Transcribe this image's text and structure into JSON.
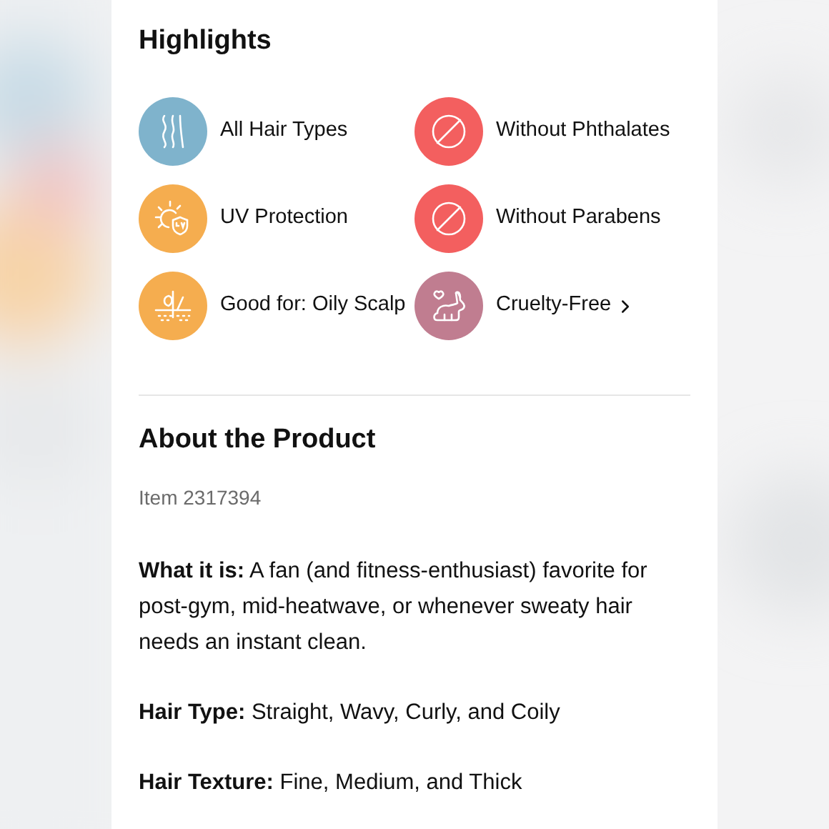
{
  "highlights": {
    "title": "Highlights",
    "items": [
      {
        "label": "All Hair Types",
        "kind": "hair",
        "color": "#7fb3cc",
        "link": false
      },
      {
        "label": "Without Phthalates",
        "kind": "no",
        "color": "#f35f5f",
        "link": false
      },
      {
        "label": "UV Protection",
        "kind": "uv",
        "color": "#f5ad4f",
        "link": false
      },
      {
        "label": "Without Parabens",
        "kind": "no",
        "color": "#f35f5f",
        "link": false
      },
      {
        "label": "Good for: Oily Scalp",
        "kind": "scalp",
        "color": "#f5ad4f",
        "link": false
      },
      {
        "label": "Cruelty-Free",
        "kind": "bunny",
        "color": "#c07d90",
        "link": true
      }
    ]
  },
  "about": {
    "title": "About the Product",
    "item": "Item 2317394",
    "paragraphs": [
      "**What it is:** A fan (and fitness-enthusiast) favorite for post-gym, mid-heatwave, or whenever sweaty hair needs an instant clean.",
      "**Hair Type:** Straight, Wavy, Curly, and Coily",
      "**Hair Texture:** Fine, Medium, and Thick"
    ]
  }
}
